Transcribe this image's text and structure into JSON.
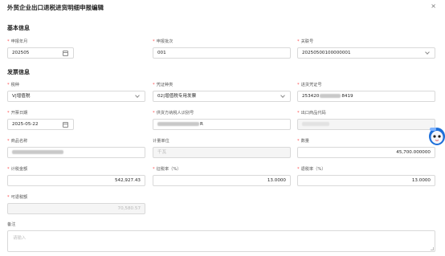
{
  "dialog": {
    "title": "外贸企业出口退税进货明细申报编辑",
    "close": "×"
  },
  "basic": {
    "title": "基本信息",
    "period_label": "申报年月",
    "period_value": "202505",
    "batch_label": "申报批次",
    "batch_value": "001",
    "customs_label": "关联号",
    "customs_value": "20250500100000001"
  },
  "invoice": {
    "title": "发票信息",
    "tax_type_label": "税种",
    "tax_type_value": "V|增值税",
    "voucher_type_label": "凭证种类",
    "voucher_type_value": "02|增值税专用发票",
    "voucher_no_label": "进货凭证号",
    "voucher_no_prefix": "253420",
    "voucher_no_suffix": "8419",
    "issue_date_label": "开票日期",
    "issue_date_value": "2025-05-22",
    "supplier_label": "供货方纳税人识别号",
    "supplier_suffix": "R",
    "export_code_label": "出口商品代码",
    "goods_name_label": "商品名称",
    "unit_label": "计量单位",
    "unit_value": "千瓦",
    "quantity_label": "数量",
    "quantity_value": "45,700.000000",
    "amount_label": "计税金额",
    "amount_value": "542,927.43",
    "levy_rate_label": "征税率（%）",
    "levy_rate_value": "13.0000",
    "refund_rate_label": "退税率（%）",
    "refund_rate_value": "13.0000",
    "refundable_label": "可退税额",
    "refundable_value": "70,580.57",
    "remark_label": "备注",
    "remark_placeholder": "请输入"
  },
  "icons": {
    "calendar": "calendar-icon",
    "chevron": "chevron-down-icon",
    "mascot": "mascot-avatar"
  },
  "colors": {
    "required": "#ff4d4f",
    "border": "#d9d9d9",
    "disabled_bg": "#f5f5f5"
  }
}
